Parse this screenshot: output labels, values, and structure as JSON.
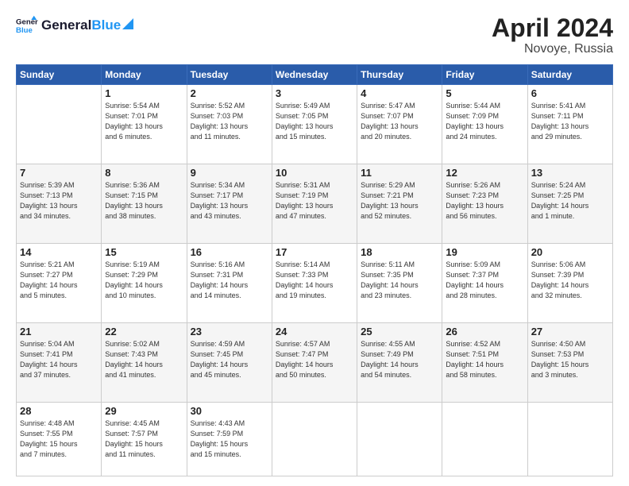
{
  "logo": {
    "text_general": "General",
    "text_blue": "Blue"
  },
  "title": {
    "month_year": "April 2024",
    "location": "Novoye, Russia"
  },
  "headers": [
    "Sunday",
    "Monday",
    "Tuesday",
    "Wednesday",
    "Thursday",
    "Friday",
    "Saturday"
  ],
  "weeks": [
    [
      {
        "day": "",
        "info": ""
      },
      {
        "day": "1",
        "info": "Sunrise: 5:54 AM\nSunset: 7:01 PM\nDaylight: 13 hours\nand 6 minutes."
      },
      {
        "day": "2",
        "info": "Sunrise: 5:52 AM\nSunset: 7:03 PM\nDaylight: 13 hours\nand 11 minutes."
      },
      {
        "day": "3",
        "info": "Sunrise: 5:49 AM\nSunset: 7:05 PM\nDaylight: 13 hours\nand 15 minutes."
      },
      {
        "day": "4",
        "info": "Sunrise: 5:47 AM\nSunset: 7:07 PM\nDaylight: 13 hours\nand 20 minutes."
      },
      {
        "day": "5",
        "info": "Sunrise: 5:44 AM\nSunset: 7:09 PM\nDaylight: 13 hours\nand 24 minutes."
      },
      {
        "day": "6",
        "info": "Sunrise: 5:41 AM\nSunset: 7:11 PM\nDaylight: 13 hours\nand 29 minutes."
      }
    ],
    [
      {
        "day": "7",
        "info": "Sunrise: 5:39 AM\nSunset: 7:13 PM\nDaylight: 13 hours\nand 34 minutes."
      },
      {
        "day": "8",
        "info": "Sunrise: 5:36 AM\nSunset: 7:15 PM\nDaylight: 13 hours\nand 38 minutes."
      },
      {
        "day": "9",
        "info": "Sunrise: 5:34 AM\nSunset: 7:17 PM\nDaylight: 13 hours\nand 43 minutes."
      },
      {
        "day": "10",
        "info": "Sunrise: 5:31 AM\nSunset: 7:19 PM\nDaylight: 13 hours\nand 47 minutes."
      },
      {
        "day": "11",
        "info": "Sunrise: 5:29 AM\nSunset: 7:21 PM\nDaylight: 13 hours\nand 52 minutes."
      },
      {
        "day": "12",
        "info": "Sunrise: 5:26 AM\nSunset: 7:23 PM\nDaylight: 13 hours\nand 56 minutes."
      },
      {
        "day": "13",
        "info": "Sunrise: 5:24 AM\nSunset: 7:25 PM\nDaylight: 14 hours\nand 1 minute."
      }
    ],
    [
      {
        "day": "14",
        "info": "Sunrise: 5:21 AM\nSunset: 7:27 PM\nDaylight: 14 hours\nand 5 minutes."
      },
      {
        "day": "15",
        "info": "Sunrise: 5:19 AM\nSunset: 7:29 PM\nDaylight: 14 hours\nand 10 minutes."
      },
      {
        "day": "16",
        "info": "Sunrise: 5:16 AM\nSunset: 7:31 PM\nDaylight: 14 hours\nand 14 minutes."
      },
      {
        "day": "17",
        "info": "Sunrise: 5:14 AM\nSunset: 7:33 PM\nDaylight: 14 hours\nand 19 minutes."
      },
      {
        "day": "18",
        "info": "Sunrise: 5:11 AM\nSunset: 7:35 PM\nDaylight: 14 hours\nand 23 minutes."
      },
      {
        "day": "19",
        "info": "Sunrise: 5:09 AM\nSunset: 7:37 PM\nDaylight: 14 hours\nand 28 minutes."
      },
      {
        "day": "20",
        "info": "Sunrise: 5:06 AM\nSunset: 7:39 PM\nDaylight: 14 hours\nand 32 minutes."
      }
    ],
    [
      {
        "day": "21",
        "info": "Sunrise: 5:04 AM\nSunset: 7:41 PM\nDaylight: 14 hours\nand 37 minutes."
      },
      {
        "day": "22",
        "info": "Sunrise: 5:02 AM\nSunset: 7:43 PM\nDaylight: 14 hours\nand 41 minutes."
      },
      {
        "day": "23",
        "info": "Sunrise: 4:59 AM\nSunset: 7:45 PM\nDaylight: 14 hours\nand 45 minutes."
      },
      {
        "day": "24",
        "info": "Sunrise: 4:57 AM\nSunset: 7:47 PM\nDaylight: 14 hours\nand 50 minutes."
      },
      {
        "day": "25",
        "info": "Sunrise: 4:55 AM\nSunset: 7:49 PM\nDaylight: 14 hours\nand 54 minutes."
      },
      {
        "day": "26",
        "info": "Sunrise: 4:52 AM\nSunset: 7:51 PM\nDaylight: 14 hours\nand 58 minutes."
      },
      {
        "day": "27",
        "info": "Sunrise: 4:50 AM\nSunset: 7:53 PM\nDaylight: 15 hours\nand 3 minutes."
      }
    ],
    [
      {
        "day": "28",
        "info": "Sunrise: 4:48 AM\nSunset: 7:55 PM\nDaylight: 15 hours\nand 7 minutes."
      },
      {
        "day": "29",
        "info": "Sunrise: 4:45 AM\nSunset: 7:57 PM\nDaylight: 15 hours\nand 11 minutes."
      },
      {
        "day": "30",
        "info": "Sunrise: 4:43 AM\nSunset: 7:59 PM\nDaylight: 15 hours\nand 15 minutes."
      },
      {
        "day": "",
        "info": ""
      },
      {
        "day": "",
        "info": ""
      },
      {
        "day": "",
        "info": ""
      },
      {
        "day": "",
        "info": ""
      }
    ]
  ]
}
